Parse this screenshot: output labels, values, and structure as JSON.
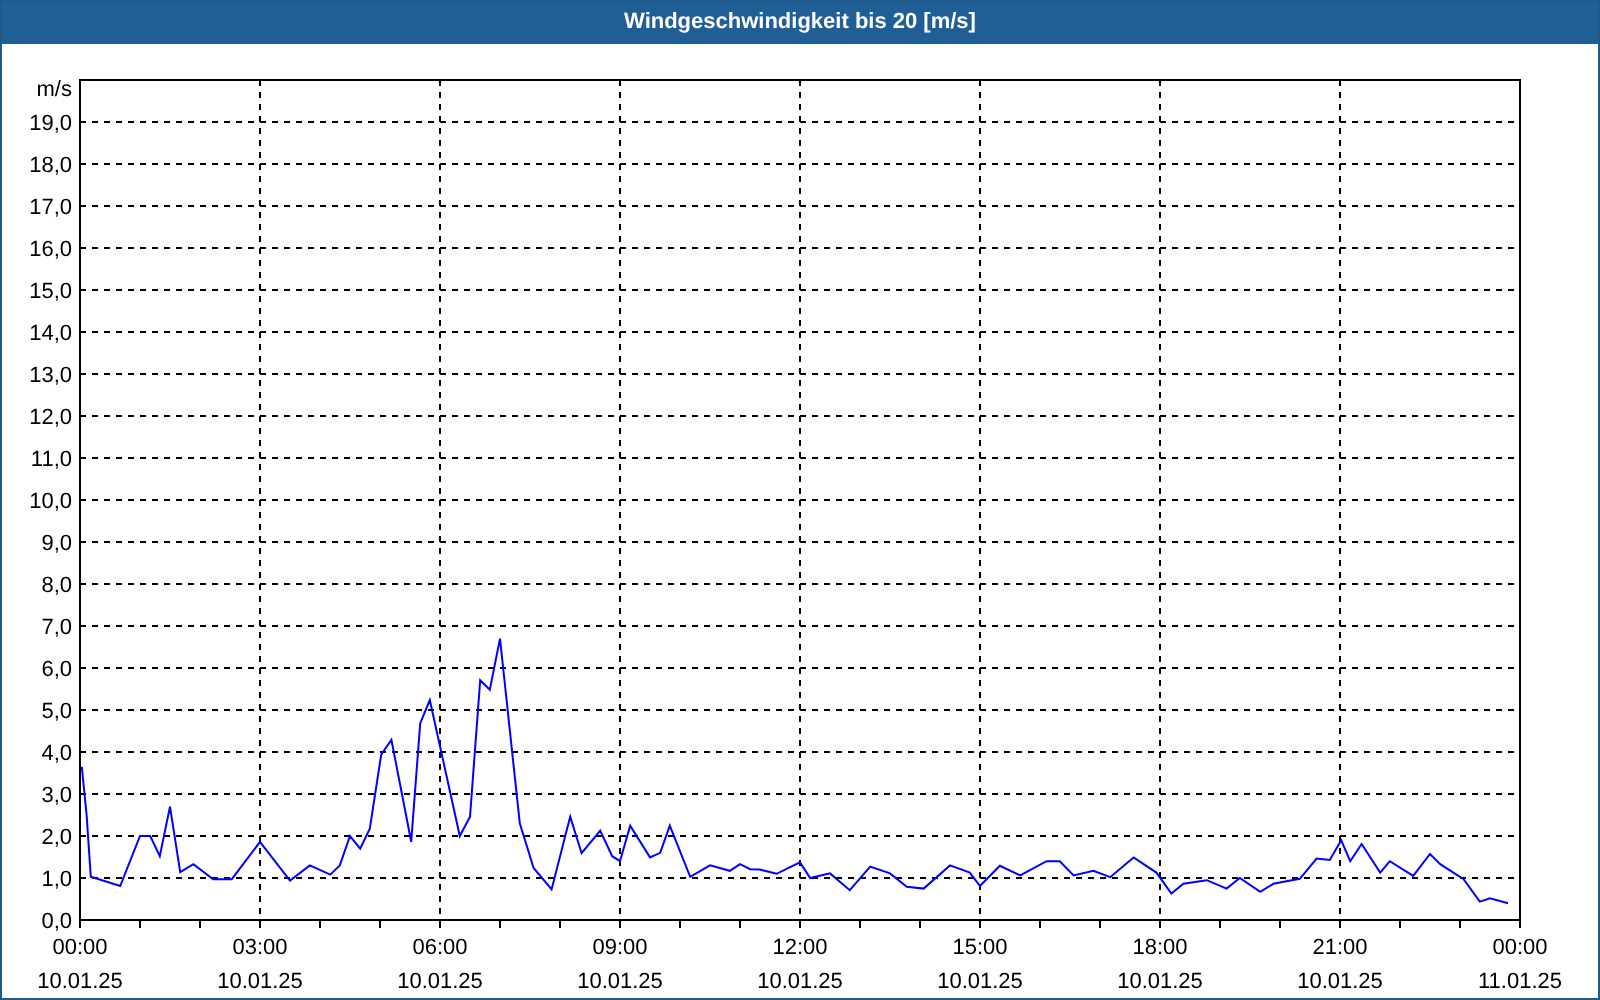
{
  "window": {
    "title": "Windgeschwindigkeit bis 20 [m/s]"
  },
  "chart": {
    "chart_data": {
      "type": "line",
      "ylabel": "m/s",
      "xlim": [
        0,
        24
      ],
      "ylim": [
        0,
        20
      ],
      "xticks": [
        {
          "value": 0,
          "label": "00:00"
        },
        {
          "value": 3,
          "label": "03:00"
        },
        {
          "value": 6,
          "label": "06:00"
        },
        {
          "value": 9,
          "label": "09:00"
        },
        {
          "value": 12,
          "label": "12:00"
        },
        {
          "value": 15,
          "label": "15:00"
        },
        {
          "value": 18,
          "label": "18:00"
        },
        {
          "value": 21,
          "label": "21:00"
        },
        {
          "value": 24,
          "label": "00:00"
        }
      ],
      "yticks": [
        {
          "value": 0,
          "label": "0,0"
        },
        {
          "value": 1,
          "label": "1,0"
        },
        {
          "value": 2,
          "label": "2,0"
        },
        {
          "value": 3,
          "label": "3,0"
        },
        {
          "value": 4,
          "label": "4,0"
        },
        {
          "value": 5,
          "label": "5,0"
        },
        {
          "value": 6,
          "label": "6,0"
        },
        {
          "value": 7,
          "label": "7,0"
        },
        {
          "value": 8,
          "label": "8,0"
        },
        {
          "value": 9,
          "label": "9,0"
        },
        {
          "value": 10,
          "label": "10,0"
        },
        {
          "value": 11,
          "label": "11,0"
        },
        {
          "value": 12,
          "label": "12,0"
        },
        {
          "value": 13,
          "label": "13,0"
        },
        {
          "value": 14,
          "label": "14,0"
        },
        {
          "value": 15,
          "label": "15,0"
        },
        {
          "value": 16,
          "label": "16,0"
        },
        {
          "value": 17,
          "label": "17,0"
        },
        {
          "value": 18,
          "label": "18,0"
        },
        {
          "value": 19,
          "label": "19,0"
        }
      ],
      "x": [
        0.03,
        0.11,
        0.18,
        0.67,
        1.0,
        1.17,
        1.33,
        1.5,
        1.67,
        1.89,
        2.22,
        2.53,
        3.0,
        3.5,
        3.83,
        4.17,
        4.33,
        4.5,
        4.67,
        4.83,
        5.02,
        5.19,
        5.52,
        5.67,
        5.83,
        6.33,
        6.5,
        6.67,
        6.83,
        7.0,
        7.33,
        7.56,
        7.86,
        8.17,
        8.36,
        8.67,
        8.87,
        9.0,
        9.17,
        9.5,
        9.67,
        9.83,
        10.17,
        10.5,
        10.83,
        11.0,
        11.17,
        11.33,
        11.61,
        12.0,
        12.17,
        12.5,
        12.83,
        13.17,
        13.5,
        13.78,
        14.06,
        14.5,
        14.83,
        15.0,
        15.33,
        15.67,
        16.11,
        16.33,
        16.56,
        16.89,
        17.17,
        17.56,
        17.94,
        18.19,
        18.39,
        18.78,
        19.11,
        19.33,
        19.67,
        19.89,
        20.33,
        20.61,
        20.83,
        21.02,
        21.17,
        21.36,
        21.67,
        21.83,
        22.22,
        22.5,
        22.67,
        23.06,
        23.33,
        23.5,
        23.8
      ],
      "grid": true,
      "series": [
        {
          "color": "#0000ff",
          "values": [
            3.65,
            2.5,
            1.03,
            0.81,
            2.0,
            2.0,
            1.52,
            2.7,
            1.14,
            1.33,
            0.97,
            0.97,
            1.86,
            0.94,
            1.3,
            1.08,
            1.3,
            2.0,
            1.7,
            2.17,
            3.94,
            4.29,
            1.86,
            4.68,
            5.24,
            2.0,
            2.46,
            5.71,
            5.48,
            6.7,
            2.3,
            1.24,
            0.73,
            2.46,
            1.59,
            2.13,
            1.52,
            1.4,
            2.25,
            1.49,
            1.6,
            2.25,
            1.03,
            1.3,
            1.17,
            1.33,
            1.21,
            1.2,
            1.1,
            1.37,
            1.0,
            1.11,
            0.71,
            1.27,
            1.11,
            0.79,
            0.75,
            1.3,
            1.13,
            0.81,
            1.29,
            1.06,
            1.4,
            1.4,
            1.06,
            1.17,
            1.02,
            1.49,
            1.13,
            0.63,
            0.86,
            0.95,
            0.75,
            1.0,
            0.67,
            0.86,
            0.98,
            1.46,
            1.43,
            1.9,
            1.4,
            1.81,
            1.13,
            1.4,
            1.05,
            1.57,
            1.33,
            0.97,
            0.44,
            0.52,
            0.4
          ]
        }
      ]
    },
    "xtick_dates": [
      "10.01.25",
      "10.01.25",
      "10.01.25",
      "10.01.25",
      "10.01.25",
      "10.01.25",
      "10.01.25",
      "10.01.25",
      "11.01.25"
    ]
  }
}
